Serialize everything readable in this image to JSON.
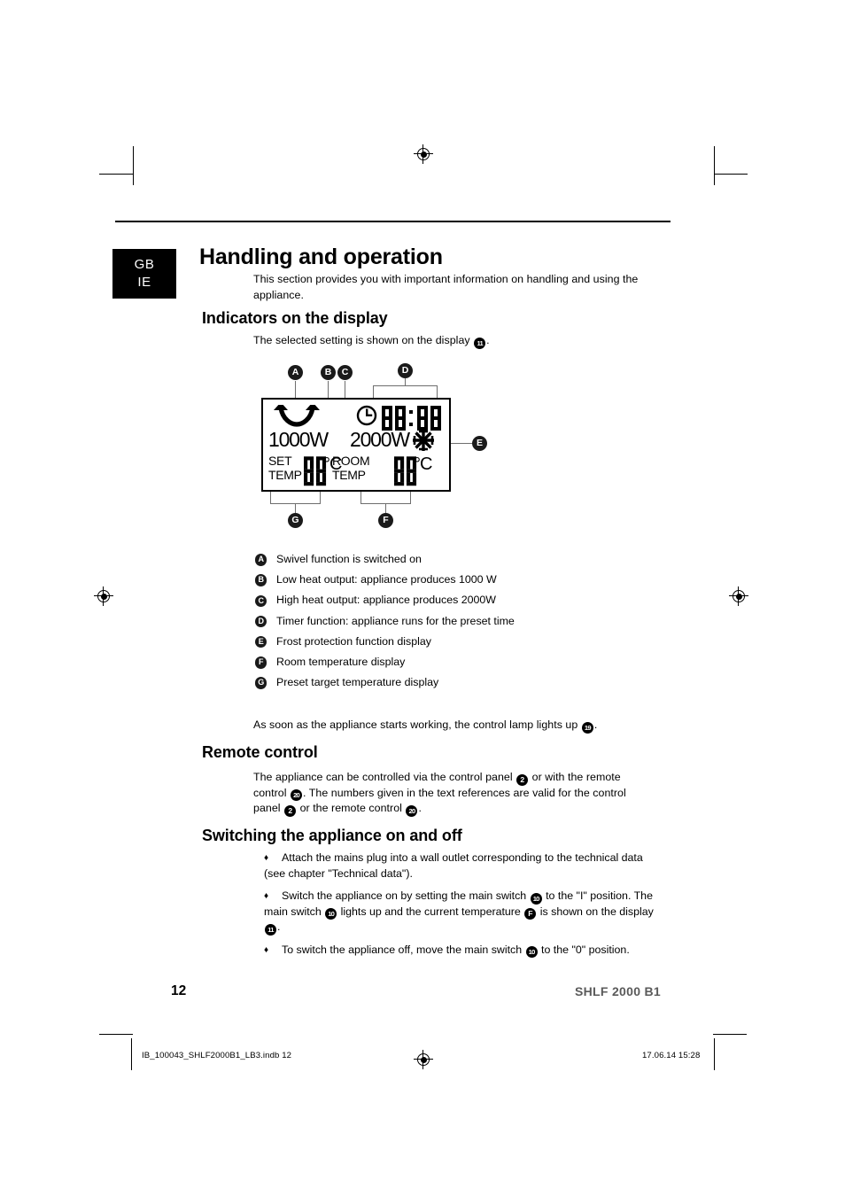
{
  "language_tab": {
    "lines": [
      "GB",
      "IE"
    ]
  },
  "headings": {
    "h1": "Handling and operation",
    "indicators": "Indicators on the display",
    "remote": "Remote control",
    "switching": "Switching the appliance on and off"
  },
  "intro": {
    "line1": "This section provides you with important information on handling and using the",
    "line2": "appliance."
  },
  "indicators_intro": {
    "pre": "The selected setting is shown on the display",
    "ref": "11",
    "post": "."
  },
  "lcd": {
    "watt_low": "1000W",
    "watt_high": "2000W",
    "timer_digits": "88:88",
    "set_label_line1": "SET",
    "set_label_line2": "TEMP",
    "set_digits": "88",
    "set_unit": "°C",
    "room_label_line1": "ROOM",
    "room_label_line2": "TEMP",
    "room_digits": "88",
    "room_unit": "°C",
    "icons": {
      "swivel": "swivel-arrow-icon",
      "clock": "clock-icon",
      "snowflake": "snowflake-icon"
    },
    "callouts": [
      "A",
      "B",
      "C",
      "D",
      "E",
      "F",
      "G"
    ]
  },
  "legend": [
    {
      "badge": "A",
      "text": "Swivel function is switched on"
    },
    {
      "badge": "B",
      "text": "Low heat output: appliance produces 1000 W"
    },
    {
      "badge": "C",
      "text": "High heat output: appliance produces 2000W"
    },
    {
      "badge": "D",
      "text": "Timer function: appliance runs for the preset time"
    },
    {
      "badge": "E",
      "text": "Frost protection function display"
    },
    {
      "badge": "F",
      "text": "Room temperature display"
    },
    {
      "badge": "G",
      "text": "Preset target temperature display"
    }
  ],
  "control_lamp": {
    "pre": "As soon as the appliance starts working, the control lamp lights up",
    "ref": "19",
    "post": "."
  },
  "remote_para": {
    "seg1": "The appliance can be controlled via the control panel",
    "ref1": "2",
    "seg2": "or with the remote control",
    "ref2": "20",
    "seg3": ". The numbers given in the text references are valid for the control panel",
    "ref3": "2",
    "seg4": "or the remote control",
    "ref4": "20",
    "seg5": "."
  },
  "bullets": [
    {
      "mark": "♦",
      "seg1": "Attach the mains plug into a wall outlet corresponding to the technical data (see chapter \"Technical data\").",
      "refs": []
    },
    {
      "mark": "♦",
      "seg1": "Switch the appliance on by setting the main switch",
      "ref1": "10",
      "seg2": "to the \"I\" position. The main switch",
      "ref2": "10",
      "seg3": "lights up and the current temperature",
      "ref3": "F",
      "seg4": "is shown on the display",
      "ref4": "11",
      "seg5": "."
    },
    {
      "mark": "♦",
      "seg1": "To switch the appliance off, move the main switch",
      "ref1": "10",
      "seg2": "to the \"0\" position.",
      "refs": []
    }
  ],
  "footer": {
    "page_number": "12",
    "model": "SHLF 2000 B1",
    "indb_file": "IB_100043_SHLF2000B1_LB3.indb   12",
    "timestamp": "17.06.14   15:28"
  }
}
